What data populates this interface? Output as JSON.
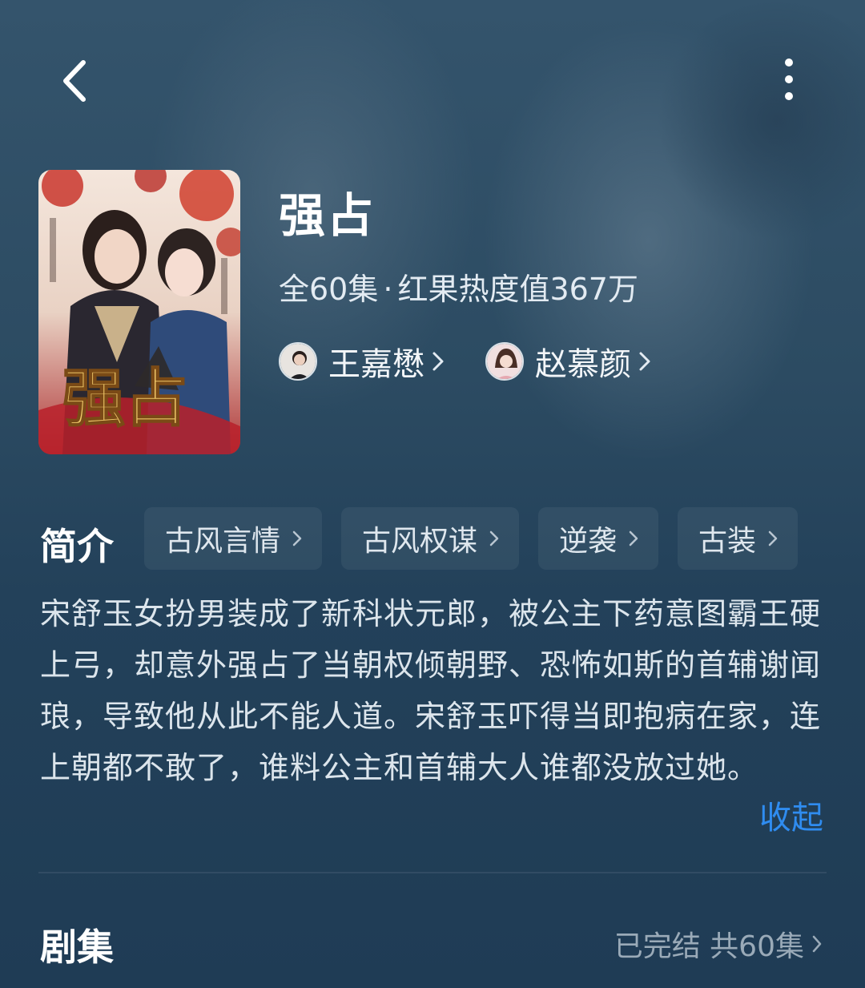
{
  "show": {
    "title": "强占",
    "meta_episodes": "全60集",
    "meta_separator": "·",
    "meta_heat": "红果热度值367万"
  },
  "actors": [
    {
      "name": "王嘉懋",
      "avatar_icon": "male-actor-avatar"
    },
    {
      "name": "赵慕颜",
      "avatar_icon": "female-actor-avatar"
    }
  ],
  "intro": {
    "label": "简介",
    "tags": [
      "古风言情",
      "古风权谋",
      "逆袭",
      "古装"
    ],
    "description": "宋舒玉女扮男装成了新科状元郎，被公主下药意图霸王硬上弓，却意外强占了当朝权倾朝野、恐怖如斯的首辅谢闻琅，导致他从此不能人道。宋舒玉吓得当即抱病在家，连上朝都不敢了，谁料公主和首辅大人谁都没放过她。",
    "collapse_label": "收起"
  },
  "episodes": {
    "label": "剧集",
    "status": "已完结 共60集"
  },
  "poster": {
    "title_art": "强占"
  },
  "colors": {
    "background": "#2c4b62",
    "accent_link": "#2f8cf0",
    "muted_text": "#9aaab8"
  }
}
